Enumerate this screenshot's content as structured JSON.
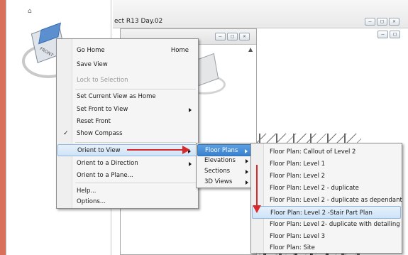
{
  "app": {
    "main_window_title": "ect R13 Day.02",
    "window_buttons": [
      "–",
      "□",
      "✕"
    ]
  },
  "viewcube": {
    "face_label": "FRONT",
    "home_icon": "home-icon"
  },
  "context_menu": {
    "items": [
      {
        "label": "Go Home",
        "shortcut": "Home"
      },
      {
        "label": "Save View"
      },
      {
        "label": "Lock to Selection",
        "disabled": true
      },
      {
        "label": "Set Current View as Home"
      },
      {
        "label": "Set Front to View",
        "submenu": true
      },
      {
        "label": "Reset Front"
      },
      {
        "label": "Show Compass",
        "checked": true
      },
      {
        "label": "Orient to View",
        "submenu": true,
        "highlighted": true
      },
      {
        "label": "Orient to a Direction",
        "submenu": true
      },
      {
        "label": "Orient to a Plane..."
      },
      {
        "label": "Help..."
      },
      {
        "label": "Options..."
      }
    ],
    "check_glyph": "✓"
  },
  "orient_submenu": {
    "items": [
      {
        "label": "Floor Plans",
        "submenu": true,
        "highlighted": true
      },
      {
        "label": "Elevations",
        "submenu": true
      },
      {
        "label": "Sections",
        "submenu": true
      },
      {
        "label": "3D Views",
        "submenu": true
      }
    ]
  },
  "floorplan_submenu": {
    "items": [
      {
        "label": "Floor Plan: Callout of Level 2"
      },
      {
        "label": "Floor Plan: Level 1"
      },
      {
        "label": "Floor Plan: Level 2"
      },
      {
        "label": "Floor Plan: Level 2 - duplicate"
      },
      {
        "label": "Floor Plan: Level 2 - duplicate as dependant"
      },
      {
        "label": "Floor Plan: Level 2 -Stair Part Plan",
        "highlighted": true
      },
      {
        "label": "Floor Plan: Level 2- duplicate with detailing"
      },
      {
        "label": "Floor Plan: Level 3"
      },
      {
        "label": "Floor Plan: Site"
      }
    ]
  },
  "colors": {
    "background": "#d9705a",
    "arrow": "#d8282a",
    "highlight": "#cfe3f7"
  }
}
